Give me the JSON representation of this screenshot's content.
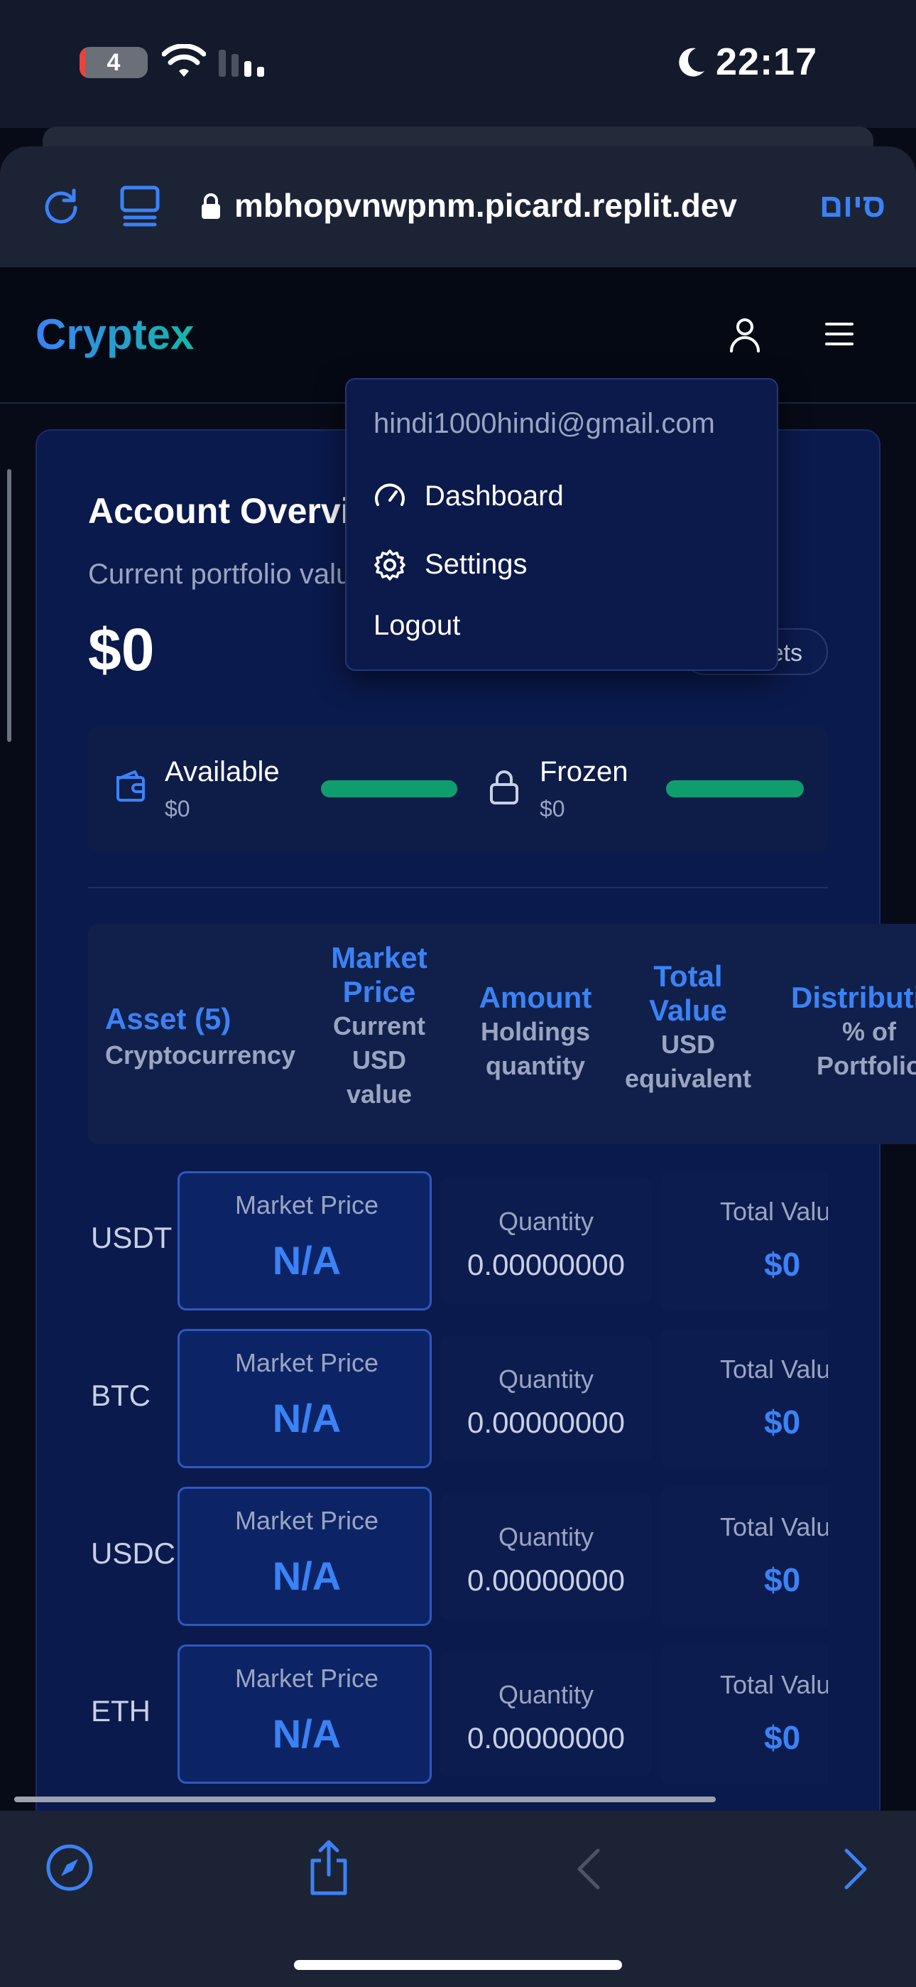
{
  "status_bar": {
    "battery": "4",
    "time": "22:17",
    "icons": [
      "wifi-icon",
      "cellular-signal-icon",
      "moon-icon"
    ]
  },
  "browser": {
    "url": "mbhopvnwpnm.picard.replit.dev",
    "done_label": "סיום",
    "icons": [
      "reload-icon",
      "reader-icon",
      "lock-icon"
    ]
  },
  "app": {
    "logo": "Cryptex",
    "brand_gradient": [
      "#3b82f6",
      "#14b8a6"
    ]
  },
  "overview": {
    "title": "Account Overview",
    "subtitle": "Current portfolio value",
    "value": "$0",
    "assets_pill": "Assets"
  },
  "balances": {
    "available": {
      "label": "Available",
      "value": "$0",
      "bar_fill": 1.0
    },
    "frozen": {
      "label": "Frozen",
      "value": "$0",
      "bar_fill": 1.0
    }
  },
  "table": {
    "columns": [
      {
        "title": "Asset (5)",
        "subtitle": "Cryptocurrency"
      },
      {
        "title": "Market Price",
        "subtitle": "Current USD value"
      },
      {
        "title": "Amount",
        "subtitle": "Holdings quantity"
      },
      {
        "title": "Total Value",
        "subtitle": "USD equivalent"
      },
      {
        "title": "Distribution",
        "subtitle": "% of Portfolio"
      }
    ],
    "rows": [
      {
        "asset": "USDT",
        "price_label": "Market Price",
        "price": "N/A",
        "qty_label": "Quantity",
        "qty": "0.00000000",
        "total_label": "Total Value",
        "total": "$0"
      },
      {
        "asset": "BTC",
        "price_label": "Market Price",
        "price": "N/A",
        "qty_label": "Quantity",
        "qty": "0.00000000",
        "total_label": "Total Value",
        "total": "$0"
      },
      {
        "asset": "USDC",
        "price_label": "Market Price",
        "price": "N/A",
        "qty_label": "Quantity",
        "qty": "0.00000000",
        "total_label": "Total Value",
        "total": "$0"
      },
      {
        "asset": "ETH",
        "price_label": "Market Price",
        "price": "N/A",
        "qty_label": "Quantity",
        "qty": "0.00000000",
        "total_label": "Total Value",
        "total": "$0"
      }
    ]
  },
  "dropdown": {
    "email": "hindi1000hindi@gmail.com",
    "dashboard": "Dashboard",
    "settings": "Settings",
    "logout": "Logout"
  },
  "colors": {
    "accent": "#3b82f6",
    "success": "#0f9d6e",
    "card_bg": "#0a1a4d"
  }
}
